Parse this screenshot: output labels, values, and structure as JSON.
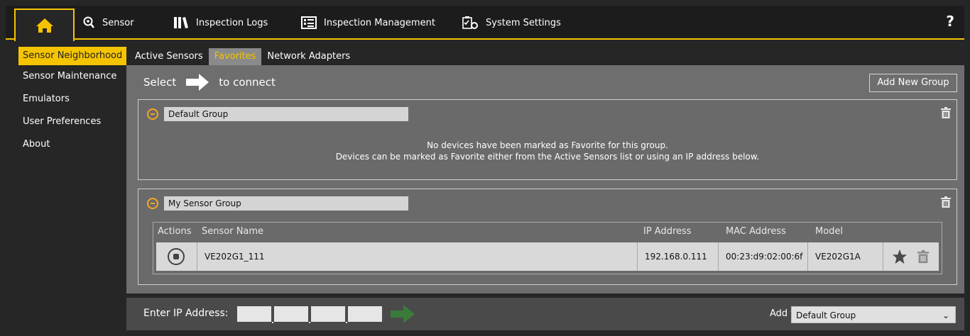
{
  "nav": {
    "items": [
      {
        "label": "Sensor",
        "icon": "sensor-icon"
      },
      {
        "label": "Inspection Logs",
        "icon": "logs-icon"
      },
      {
        "label": "Inspection Management",
        "icon": "management-icon"
      },
      {
        "label": "System Settings",
        "icon": "settings-icon"
      }
    ],
    "help": "?"
  },
  "sidebar": {
    "items": [
      {
        "label": "Sensor Neighborhood",
        "active": true
      },
      {
        "label": "Sensor Maintenance"
      },
      {
        "label": "Emulators"
      },
      {
        "label": "User Preferences"
      },
      {
        "label": "About"
      }
    ]
  },
  "subtabs": [
    {
      "label": "Active Sensors"
    },
    {
      "label": "Favorites",
      "active": true
    },
    {
      "label": "Network Adapters"
    }
  ],
  "main": {
    "select_text": "Select",
    "connect_text": "to connect",
    "add_group_label": "Add New Group",
    "groups": [
      {
        "name": "Default Group",
        "empty_line1": "No devices have been marked as Favorite for this group.",
        "empty_line2": "Devices can be marked as Favorite either from the Active Sensors list or using an IP address below."
      },
      {
        "name": "My Sensor Group",
        "columns": [
          "Actions",
          "Sensor Name",
          "IP Address",
          "MAC Address",
          "Model"
        ],
        "rows": [
          {
            "sensor_name": "VE202G1_111",
            "ip": "192.168.0.111",
            "mac": "00:23:d9:02:00:6f",
            "model": "VE202G1A"
          }
        ]
      }
    ]
  },
  "bottom": {
    "ip_label": "Enter IP Address:",
    "add_to_label": "Add to",
    "add_to_value": "Default Group"
  },
  "colors": {
    "accent": "#f5c400",
    "collapse": "#f5a623",
    "go_arrow": "#3a7a3a"
  }
}
